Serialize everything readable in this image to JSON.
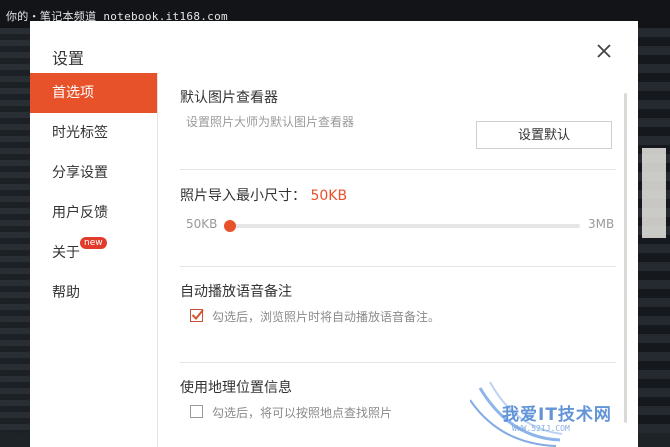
{
  "caption": "你的・笔记本频道 notebook.it168.com",
  "dialog": {
    "title": "设置",
    "close_icon": "close-icon"
  },
  "sidebar": {
    "items": [
      {
        "label": "首选项",
        "active": true
      },
      {
        "label": "时光标签",
        "active": false
      },
      {
        "label": "分享设置",
        "active": false
      },
      {
        "label": "用户反馈",
        "active": false
      },
      {
        "label": "关于",
        "active": false,
        "badge": "new"
      },
      {
        "label": "帮助",
        "active": false
      }
    ]
  },
  "default_viewer": {
    "title": "默认图片查看器",
    "description": "设置照片大师为默认图片查看器",
    "button_label": "设置默认"
  },
  "import_size": {
    "label": "照片导入最小尺寸：",
    "value": "50KB",
    "min_label": "50KB",
    "max_label": "3MB",
    "slider_fraction": 0
  },
  "voice_memo": {
    "title": "自动播放语音备注",
    "checkbox_label": "勾选后，浏览照片时将自动播放语音备注。",
    "checked": true
  },
  "geo_info": {
    "title": "使用地理位置信息",
    "checkbox_label": "勾选后，将可以按照地点查找照片",
    "checked": false
  },
  "watermark": {
    "text": "我爱IT技术网",
    "sub": "WWW.52IJ.COM"
  },
  "colors": {
    "accent": "#e8522a",
    "badge": "#e23b2c"
  }
}
